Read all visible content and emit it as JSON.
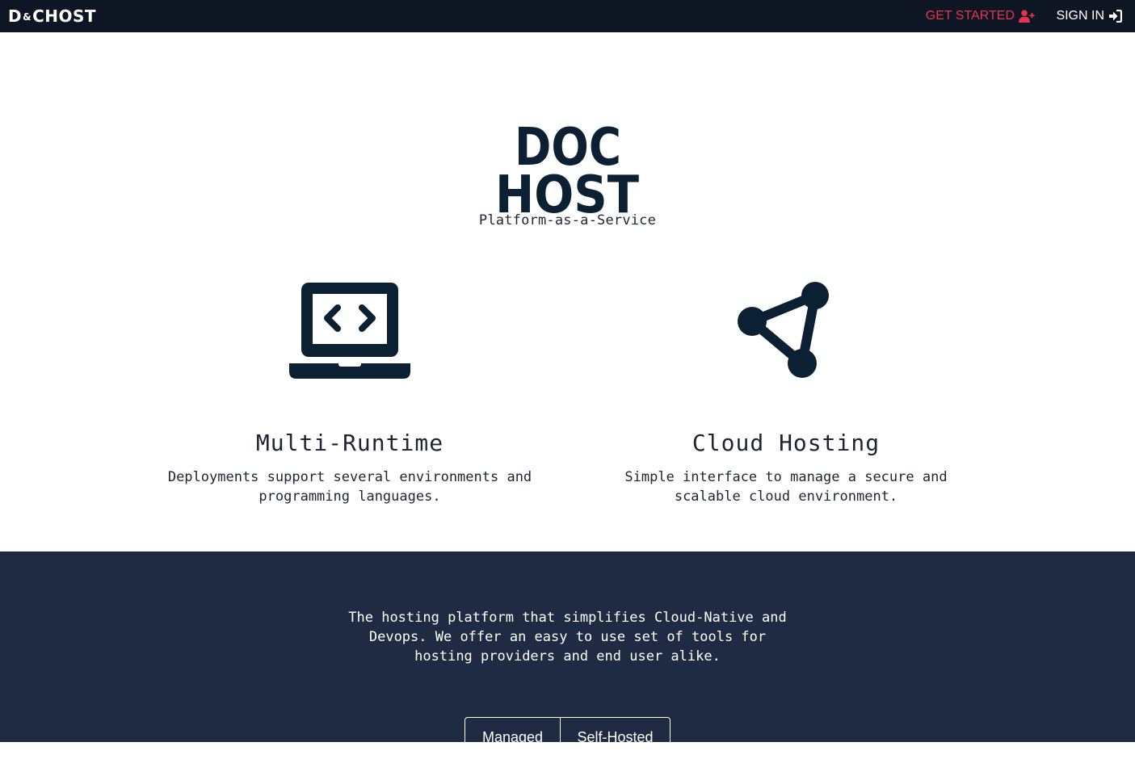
{
  "navbar": {
    "brand": {
      "first": "D",
      "amp": "&",
      "rest": "CHOST"
    },
    "get_started": "GET STARTED",
    "get_started_icon": "user-plus-icon",
    "sign_in": "SIGN IN",
    "sign_in_icon": "sign-in-icon"
  },
  "hero": {
    "logo_line1": "DOC",
    "logo_line2": "HOST",
    "tagline": "Platform-as-a-Service"
  },
  "features": [
    {
      "icon": "laptop-code-icon",
      "title": "Multi-Runtime",
      "description": "Deployments support several environments and programming languages."
    },
    {
      "icon": "network-triangle-icon",
      "title": "Cloud Hosting",
      "description": "Simple interface to manage a secure and scalable cloud environment."
    }
  ],
  "band": {
    "text": "The hosting platform that simplifies Cloud-Native and Devops. We offer an easy to use set of tools for hosting providers and end user alike.",
    "buttons": [
      "Managed",
      "Self-Hosted"
    ]
  },
  "colors": {
    "navbar_bg": "#0e1623",
    "accent_red": "#e8334f",
    "dark_navy": "#0b2032",
    "band_bg": "#1f2b42"
  }
}
